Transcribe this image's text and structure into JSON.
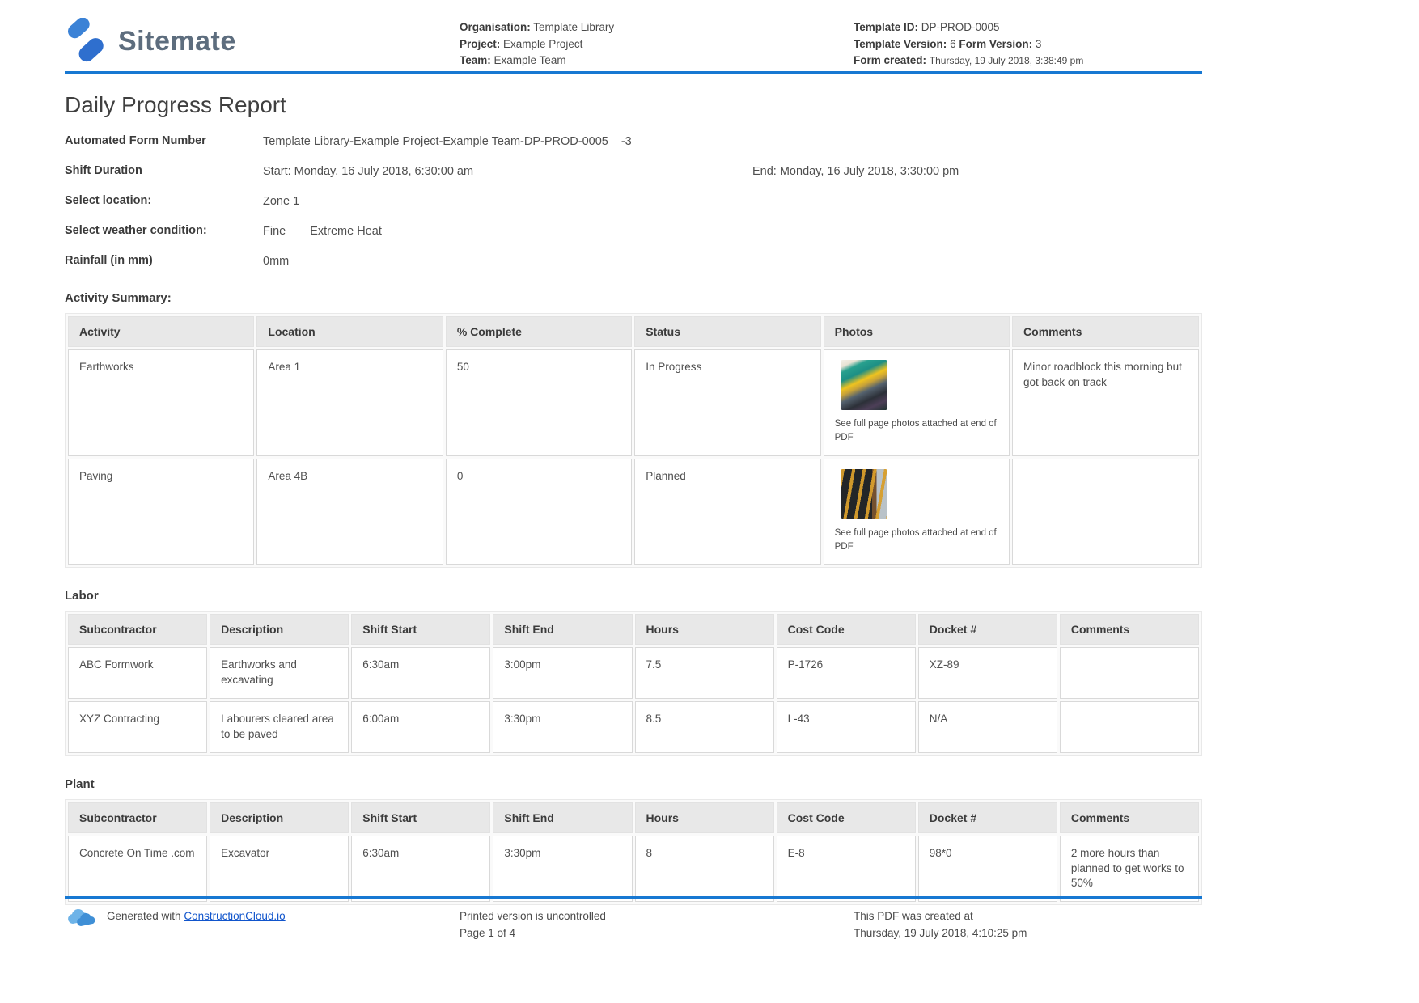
{
  "colors": {
    "accent_blue": "#1778d2",
    "link_blue": "#1155cc",
    "logo_blue": "#3b82d6",
    "logo_text_gray": "#5d6d7e"
  },
  "header": {
    "logo_text": "Sitemate",
    "org_label": "Organisation:",
    "org_value": "Template Library",
    "project_label": "Project:",
    "project_value": "Example Project",
    "team_label": "Team:",
    "team_value": "Example Team",
    "template_id_label": "Template ID:",
    "template_id_value": "DP-PROD-0005",
    "template_version_label": "Template Version:",
    "template_version_value": "6",
    "form_version_label": "Form Version:",
    "form_version_value": "3",
    "form_created_label": "Form created:",
    "form_created_value": "Thursday, 19 July 2018, 3:38:49 pm"
  },
  "title": "Daily Progress Report",
  "fields": {
    "automated_form": {
      "label": "Automated Form Number",
      "value": "Template Library-Example Project-Example Team-DP-PROD-0005",
      "suffix": "-3"
    },
    "shift": {
      "label": "Shift Duration",
      "start": "Start: Monday, 16 July 2018, 6:30:00 am",
      "end": "End: Monday, 16 July 2018, 3:30:00 pm"
    },
    "location": {
      "label": "Select location:",
      "value": "Zone 1"
    },
    "weather": {
      "label": "Select weather condition:",
      "value1": "Fine",
      "value2": "Extreme Heat"
    },
    "rainfall": {
      "label": "Rainfall (in mm)",
      "value": "0mm"
    }
  },
  "activity_summary": {
    "heading": "Activity Summary:",
    "columns": [
      "Activity",
      "Location",
      "% Complete",
      "Status",
      "Photos",
      "Comments"
    ],
    "photo_note": "See full page photos attached at end of PDF",
    "rows": [
      {
        "activity": "Earthworks",
        "location": "Area 1",
        "complete": "50",
        "status": "In Progress",
        "comments": "Minor roadblock this morning but got back on track"
      },
      {
        "activity": "Paving",
        "location": "Area 4B",
        "complete": "0",
        "status": "Planned",
        "comments": ""
      }
    ]
  },
  "labor": {
    "heading": "Labor",
    "columns": [
      "Subcontractor",
      "Description",
      "Shift Start",
      "Shift End",
      "Hours",
      "Cost Code",
      "Docket #",
      "Comments"
    ],
    "rows": [
      {
        "subcontractor": "ABC Formwork",
        "description": "Earthworks and excavating",
        "shift_start": "6:30am",
        "shift_end": "3:00pm",
        "hours": "7.5",
        "cost_code": "P-1726",
        "docket": "XZ-89",
        "comments": ""
      },
      {
        "subcontractor": "XYZ Contracting",
        "description": "Labourers cleared area to be paved",
        "shift_start": "6:00am",
        "shift_end": "3:30pm",
        "hours": "8.5",
        "cost_code": "L-43",
        "docket": "N/A",
        "comments": ""
      }
    ]
  },
  "plant": {
    "heading": "Plant",
    "columns": [
      "Subcontractor",
      "Description",
      "Shift Start",
      "Shift End",
      "Hours",
      "Cost Code",
      "Docket #",
      "Comments"
    ],
    "rows": [
      {
        "subcontractor": "Concrete On Time .com",
        "description": "Excavator",
        "shift_start": "6:30am",
        "shift_end": "3:30pm",
        "hours": "8",
        "cost_code": "E-8",
        "docket": "98*0",
        "comments": "2 more hours than planned to get works to 50%"
      }
    ]
  },
  "footer": {
    "generated_prefix": "Generated with",
    "generated_link": "ConstructionCloud.io",
    "printed_note": "Printed version is uncontrolled",
    "page_info": "Page 1 of 4",
    "created_line1": "This PDF was created at",
    "created_line2": "Thursday, 19 July 2018, 4:10:25 pm"
  }
}
